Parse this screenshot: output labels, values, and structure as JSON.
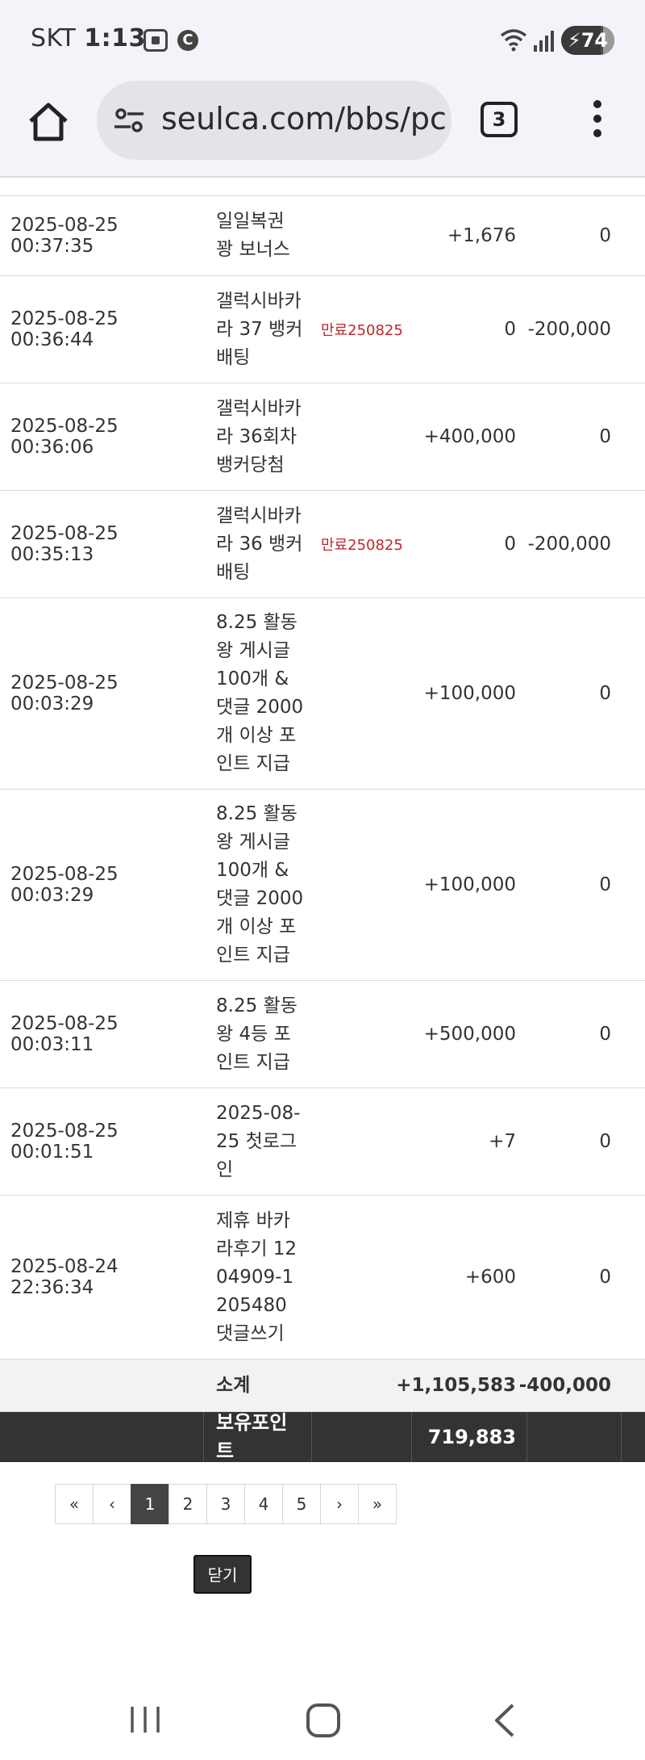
{
  "status_bar": {
    "carrier": "SKT",
    "time": "1:13",
    "notification_badge": "C",
    "battery_level": "74",
    "battery_fraction": 0.74
  },
  "browser": {
    "url": "seulca.com/bbs/pc",
    "tab_count": "3"
  },
  "rows": [
    {
      "date": "2025-08-25 00:37:35",
      "desc": "일일복권 꽝 보너스",
      "note": "",
      "plus": "+1,676",
      "minus": "0"
    },
    {
      "date": "2025-08-25 00:36:44",
      "desc": "갤럭시바카라 37 뱅커배팅",
      "note": "만료250825",
      "plus": "0",
      "minus": "-200,000"
    },
    {
      "date": "2025-08-25 00:36:06",
      "desc": "갤럭시바카라 36회차 뱅커당첨",
      "note": "",
      "plus": "+400,000",
      "minus": "0"
    },
    {
      "date": "2025-08-25 00:35:13",
      "desc": "갤럭시바카라 36 뱅커배팅",
      "note": "만료250825",
      "plus": "0",
      "minus": "-200,000"
    },
    {
      "date": "2025-08-25 00:03:29",
      "desc": "8.25 활동왕 게시글 100개 & 댓글 2000개 이상 포인트 지급",
      "note": "",
      "plus": "+100,000",
      "minus": "0"
    },
    {
      "date": "2025-08-25 00:03:29",
      "desc": "8.25 활동왕 게시글 100개 & 댓글 2000개 이상 포인트 지급",
      "note": "",
      "plus": "+100,000",
      "minus": "0"
    },
    {
      "date": "2025-08-25 00:03:11",
      "desc": "8.25 활동왕 4등 포인트 지급",
      "note": "",
      "plus": "+500,000",
      "minus": "0"
    },
    {
      "date": "2025-08-25 00:01:51",
      "desc": "2025-08-25 첫로그인",
      "note": "",
      "plus": "+7",
      "minus": "0"
    },
    {
      "date": "2025-08-24 22:36:34",
      "desc": "제휴 바카라후기 1204909-1205480 댓글쓰기",
      "note": "",
      "plus": "+600",
      "minus": "0"
    }
  ],
  "subtotal": {
    "label": "소계",
    "plus": "+1,105,583",
    "minus": "-400,000"
  },
  "total": {
    "label": "보유포인트",
    "value": "719,883"
  },
  "pagination": {
    "first": "«",
    "prev": "‹",
    "pages": [
      "1",
      "2",
      "3",
      "4",
      "5"
    ],
    "active": "1",
    "next": "›",
    "last": "»"
  },
  "close_label": "닫기"
}
